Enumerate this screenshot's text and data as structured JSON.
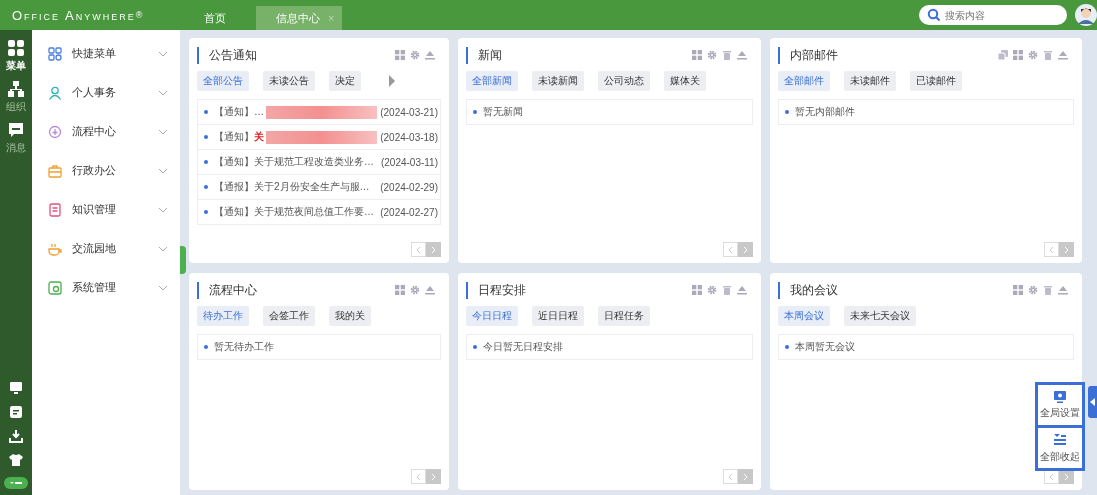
{
  "brand": {
    "name": "Office Anywhere",
    "mark": "®"
  },
  "tabs": [
    {
      "label": "首页",
      "selected": false
    },
    {
      "label": "信息中心",
      "selected": true,
      "close": "×"
    }
  ],
  "search": {
    "placeholder": "搜索内容"
  },
  "rail": [
    {
      "label": "菜单",
      "selected": true
    },
    {
      "label": "组织",
      "selected": false
    },
    {
      "label": "消息",
      "selected": false
    }
  ],
  "menu": [
    {
      "label": "快捷菜单"
    },
    {
      "label": "个人事务"
    },
    {
      "label": "流程中心"
    },
    {
      "label": "行政办公"
    },
    {
      "label": "知识管理"
    },
    {
      "label": "交流园地"
    },
    {
      "label": "系统管理"
    }
  ],
  "cards": [
    {
      "title": "公告通知",
      "tools": [
        {
          "kind": "grid"
        },
        {
          "kind": "gear"
        },
        {
          "kind": "collapse"
        }
      ],
      "more": true,
      "tabs": [
        {
          "label": "全部公告",
          "selected": true
        },
        {
          "label": "未读公告",
          "selected": false
        },
        {
          "label": "决定",
          "selected": false
        }
      ],
      "items": [
        {
          "prefix": "【通知】",
          "redacted": true,
          "tail": "…",
          "date": "(2024-03-21)"
        },
        {
          "prefix": "【通知】",
          "text": "关",
          "color": "#e02020",
          "redacted": true,
          "date": "(2024-03-18)"
        },
        {
          "prefix": "【通知】",
          "text": "关于规范工程改造类业务…",
          "date": "(2024-03-11)"
        },
        {
          "prefix": "【通报】",
          "text": "关于2月份安全生产与服…",
          "date": "(2024-02-29)"
        },
        {
          "prefix": "【通知】",
          "text": "关于规范夜间总值工作要…",
          "date": "(2024-02-27)"
        }
      ]
    },
    {
      "title": "新闻",
      "tools": [
        {
          "kind": "grid"
        },
        {
          "kind": "gear"
        },
        {
          "kind": "trash"
        },
        {
          "kind": "collapse"
        }
      ],
      "tabs": [
        {
          "label": "全部新闻",
          "selected": true
        },
        {
          "label": "未读新闻",
          "selected": false
        },
        {
          "label": "公司动态",
          "selected": false
        },
        {
          "label": "媒体关",
          "selected": false
        }
      ],
      "items": [
        {
          "text": "暂无新闻"
        }
      ]
    },
    {
      "title": "内部邮件",
      "tools": [
        {
          "kind": "copy"
        },
        {
          "kind": "grid"
        },
        {
          "kind": "gear"
        },
        {
          "kind": "trash"
        },
        {
          "kind": "collapse"
        }
      ],
      "tabs": [
        {
          "label": "全部邮件",
          "selected": true
        },
        {
          "label": "未读邮件",
          "selected": false
        },
        {
          "label": "已读邮件",
          "selected": false
        }
      ],
      "items": [
        {
          "text": "暂无内部邮件"
        }
      ]
    },
    {
      "title": "流程中心",
      "tools": [
        {
          "kind": "grid"
        },
        {
          "kind": "gear"
        },
        {
          "kind": "collapse"
        }
      ],
      "tabs": [
        {
          "label": "待办工作",
          "selected": true
        },
        {
          "label": "会签工作",
          "selected": false
        },
        {
          "label": "我的关",
          "selected": false
        }
      ],
      "items": [
        {
          "text": "暂无待办工作"
        }
      ]
    },
    {
      "title": "日程安排",
      "tools": [
        {
          "kind": "grid"
        },
        {
          "kind": "gear"
        },
        {
          "kind": "trash"
        },
        {
          "kind": "collapse"
        }
      ],
      "tabs": [
        {
          "label": "今日日程",
          "selected": true
        },
        {
          "label": "近日日程",
          "selected": false
        },
        {
          "label": "日程任务",
          "selected": false
        }
      ],
      "items": [
        {
          "text": "今日暂无日程安排"
        }
      ]
    },
    {
      "title": "我的会议",
      "tools": [
        {
          "kind": "grid"
        },
        {
          "kind": "gear"
        },
        {
          "kind": "trash"
        },
        {
          "kind": "collapse"
        }
      ],
      "tabs": [
        {
          "label": "本周会议",
          "selected": true
        },
        {
          "label": "未来七天会议",
          "selected": false
        }
      ],
      "items": [
        {
          "text": "本周暂无会议"
        }
      ]
    }
  ],
  "float_buttons": [
    {
      "label": "全局设置"
    },
    {
      "label": "全部收起"
    }
  ]
}
